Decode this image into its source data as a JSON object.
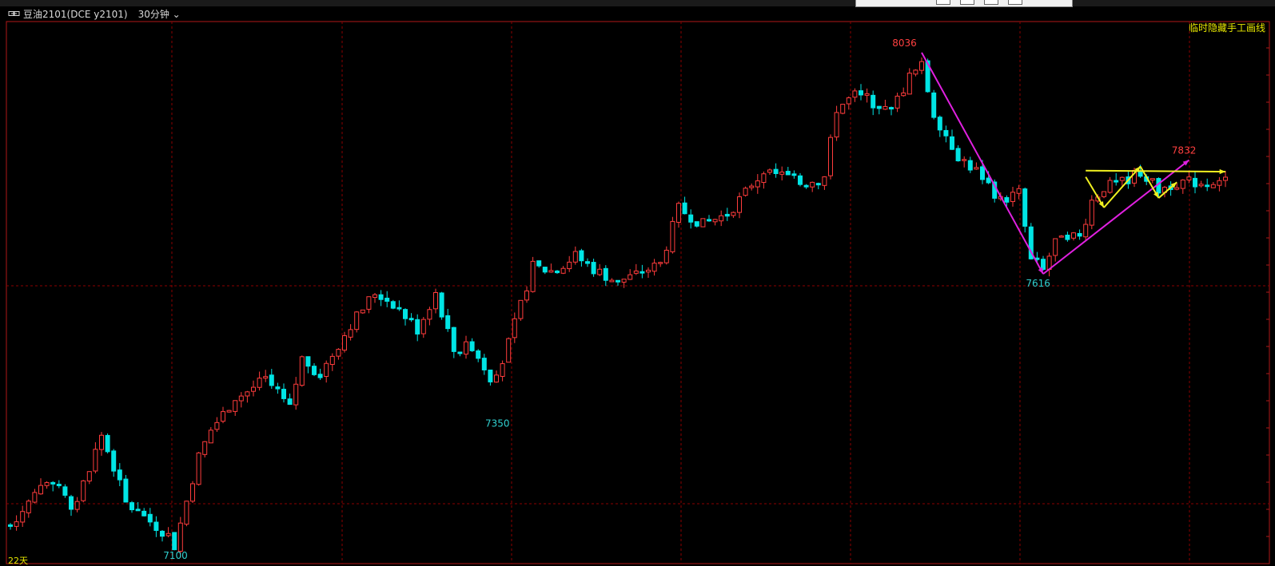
{
  "header": {
    "instrument_label": "豆油2101(DCE y2101)",
    "period_label": "30分钟",
    "right_label": "临时隐藏手工画线",
    "bottom_left_label": "22天"
  },
  "colors": {
    "up": "#ff3c3c",
    "down": "#00e5e5",
    "grid": "#8b0000",
    "frame": "#b01818",
    "trend_magenta": "#e020e0",
    "trend_yellow": "#f0f020",
    "label_red": "#ff4040",
    "label_cyan": "#30d0d0",
    "label_yellow": "#e8e800"
  },
  "chart_data": {
    "type": "candlestick",
    "title": "豆油2101(DCE y2101)",
    "period": "30分钟",
    "ylim": [
      7080,
      8060
    ],
    "grid": true,
    "price_labels": [
      {
        "text": "8036",
        "value": 8036,
        "index": 147,
        "color": "red"
      },
      {
        "text": "7100",
        "value": 7100,
        "index": 27,
        "color": "cyan"
      },
      {
        "text": "7350",
        "value": 7350,
        "index": 80,
        "color": "cyan"
      },
      {
        "text": "7616",
        "value": 7616,
        "index": 169,
        "color": "cyan"
      },
      {
        "text": "7832",
        "value": 7832,
        "index": 193,
        "color": "red"
      }
    ],
    "trendlines": [
      {
        "color": "magenta",
        "from": [
          150,
          8036
        ],
        "to": [
          170,
          7616
        ]
      },
      {
        "color": "magenta",
        "from": [
          170,
          7616
        ],
        "to": [
          194,
          7832
        ]
      },
      {
        "color": "yellow",
        "from": [
          177,
          7812
        ],
        "to": [
          200,
          7810
        ]
      },
      {
        "color": "yellow",
        "points": [
          [
            177,
            7800
          ],
          [
            180,
            7742
          ],
          [
            186,
            7820
          ],
          [
            189,
            7760
          ],
          [
            192,
            7790
          ]
        ]
      }
    ],
    "anchors": [
      [
        0,
        7140
      ],
      [
        4,
        7200
      ],
      [
        8,
        7220
      ],
      [
        10,
        7160
      ],
      [
        15,
        7310
      ],
      [
        17,
        7250
      ],
      [
        19,
        7180
      ],
      [
        22,
        7155
      ],
      [
        26,
        7120
      ],
      [
        27,
        7100
      ],
      [
        31,
        7270
      ],
      [
        33,
        7320
      ],
      [
        37,
        7380
      ],
      [
        42,
        7415
      ],
      [
        46,
        7360
      ],
      [
        48,
        7455
      ],
      [
        51,
        7425
      ],
      [
        56,
        7520
      ],
      [
        60,
        7580
      ],
      [
        63,
        7560
      ],
      [
        67,
        7510
      ],
      [
        70,
        7580
      ],
      [
        73,
        7470
      ],
      [
        76,
        7480
      ],
      [
        79,
        7420
      ],
      [
        81,
        7450
      ],
      [
        83,
        7520
      ],
      [
        86,
        7630
      ],
      [
        89,
        7620
      ],
      [
        93,
        7650
      ],
      [
        96,
        7625
      ],
      [
        100,
        7600
      ],
      [
        104,
        7620
      ],
      [
        107,
        7635
      ],
      [
        110,
        7740
      ],
      [
        114,
        7710
      ],
      [
        118,
        7730
      ],
      [
        121,
        7770
      ],
      [
        124,
        7810
      ],
      [
        128,
        7800
      ],
      [
        131,
        7790
      ],
      [
        134,
        7800
      ],
      [
        136,
        7930
      ],
      [
        139,
        7955
      ],
      [
        142,
        7940
      ],
      [
        145,
        7925
      ],
      [
        148,
        7990
      ],
      [
        150,
        8010
      ],
      [
        152,
        7920
      ],
      [
        156,
        7840
      ],
      [
        160,
        7800
      ],
      [
        163,
        7755
      ],
      [
        166,
        7770
      ],
      [
        168,
        7640
      ],
      [
        170,
        7630
      ],
      [
        173,
        7695
      ],
      [
        176,
        7685
      ],
      [
        178,
        7755
      ],
      [
        180,
        7780
      ],
      [
        183,
        7790
      ],
      [
        186,
        7810
      ],
      [
        189,
        7775
      ],
      [
        192,
        7790
      ],
      [
        195,
        7790
      ],
      [
        198,
        7780
      ],
      [
        200,
        7790
      ]
    ],
    "n_bars": 201
  }
}
